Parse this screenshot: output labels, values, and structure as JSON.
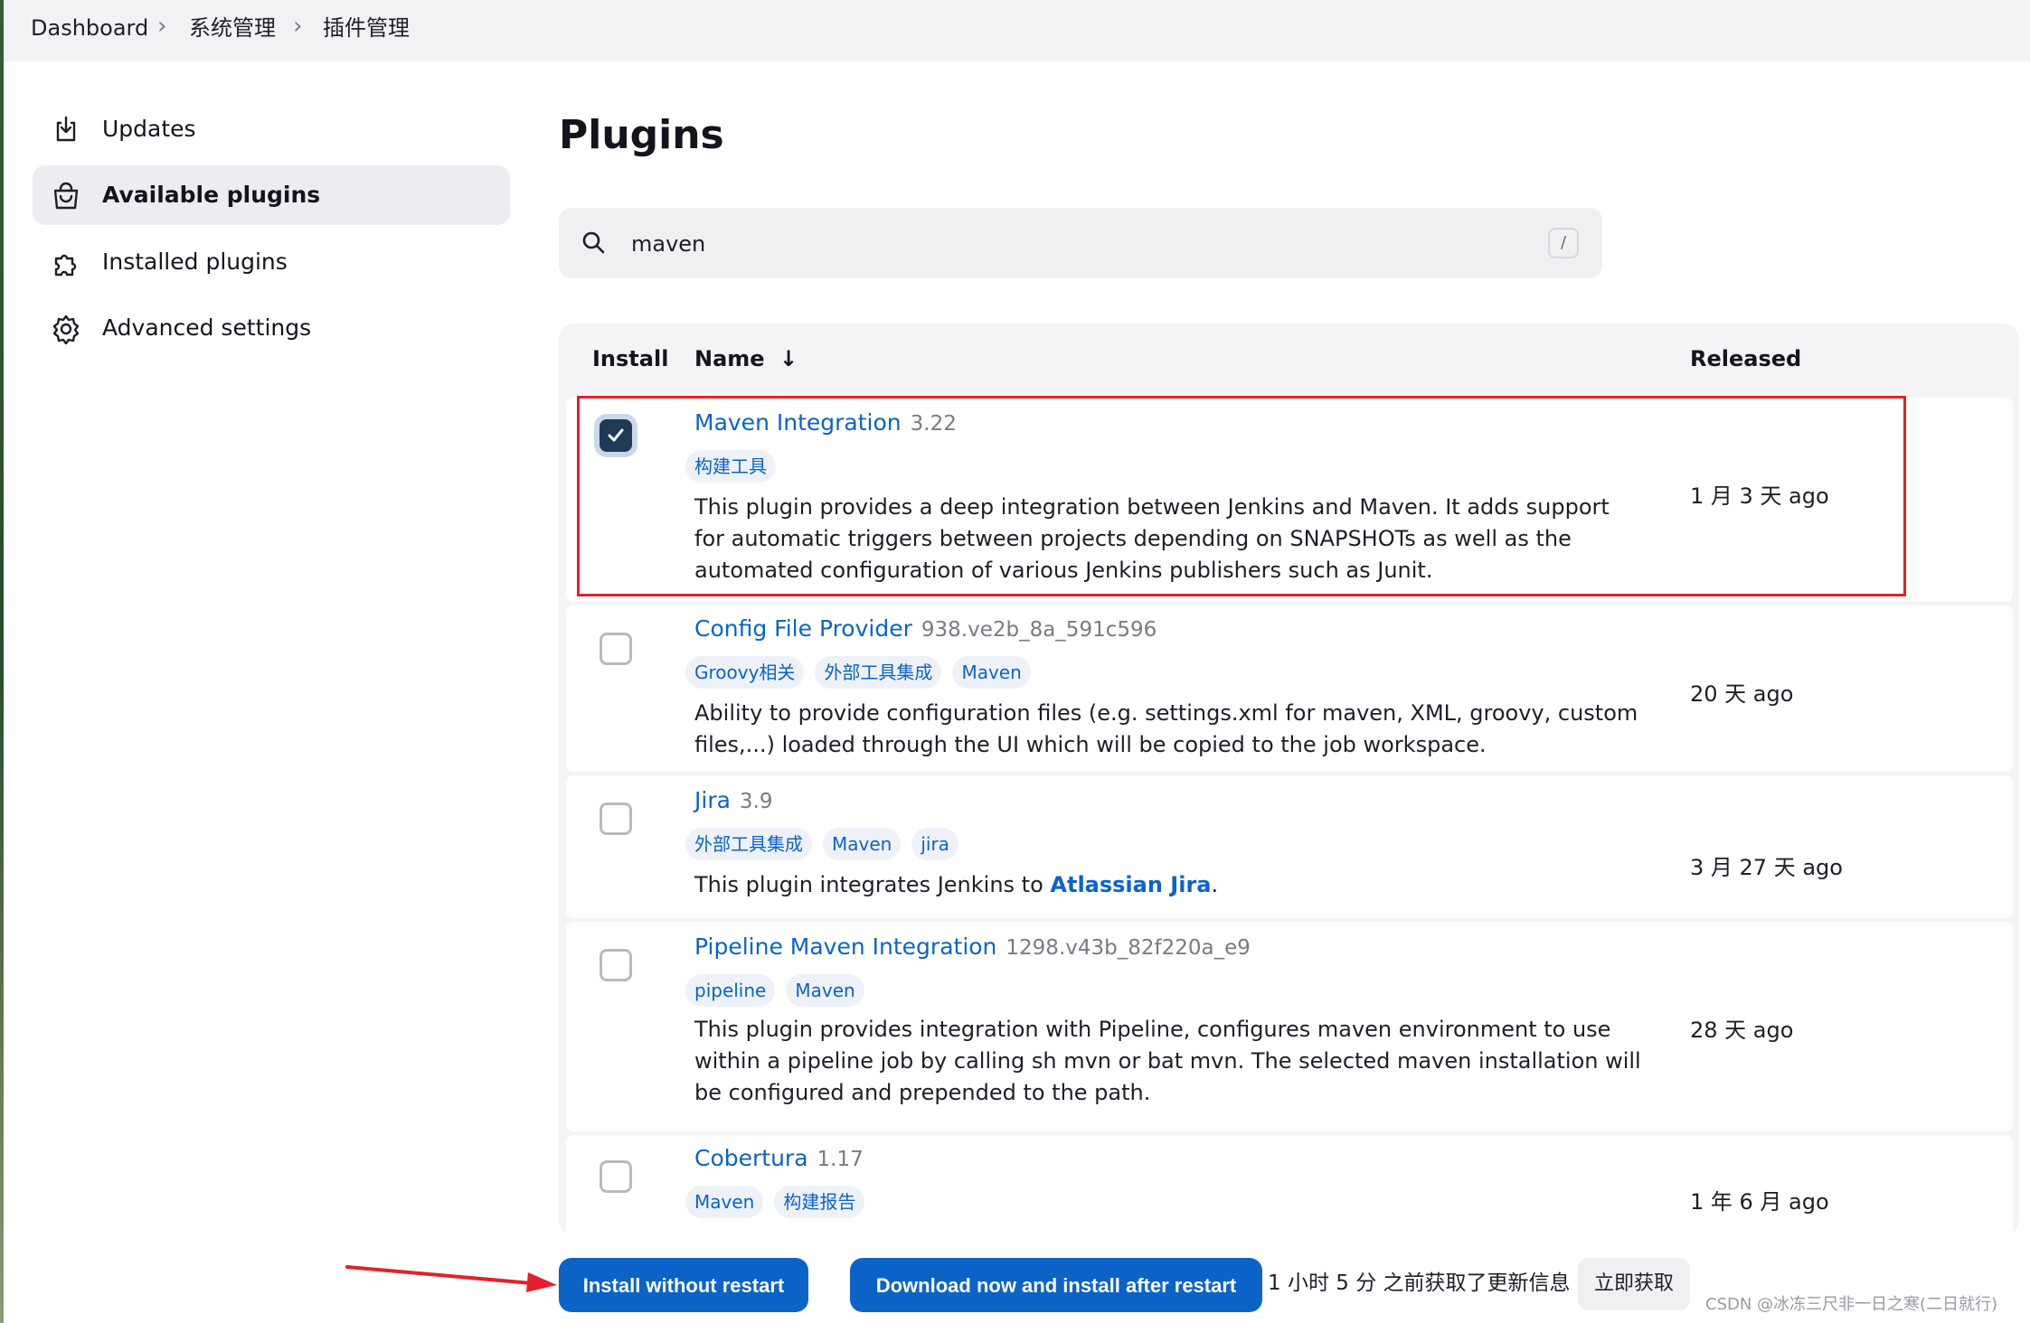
{
  "breadcrumb": {
    "items": [
      "Dashboard",
      "系统管理",
      "插件管理"
    ]
  },
  "sidebar": {
    "items": [
      {
        "label": "Updates",
        "icon": "download-icon"
      },
      {
        "label": "Available plugins",
        "icon": "shopping-bag-icon",
        "active": true
      },
      {
        "label": "Installed plugins",
        "icon": "puzzle-icon"
      },
      {
        "label": "Advanced settings",
        "icon": "gear-icon"
      }
    ]
  },
  "main": {
    "title": "Plugins",
    "search": {
      "value": "maven",
      "shortcut": "/"
    },
    "table": {
      "headers": {
        "install": "Install",
        "name": "Name",
        "sort_indicator": "↓",
        "released": "Released"
      },
      "rows": [
        {
          "name": "Maven Integration",
          "version": "3.22",
          "checked": true,
          "tags": [
            "构建工具"
          ],
          "description": "This plugin provides a deep integration between Jenkins and Maven. It adds support for automatic triggers between projects depending on SNAPSHOTs as well as the automated configuration of various Jenkins publishers such as Junit.",
          "released": "1 月 3 天 ago"
        },
        {
          "name": "Config File Provider",
          "version": "938.ve2b_8a_591c596",
          "checked": false,
          "tags": [
            "Groovy相关",
            "外部工具集成",
            "Maven"
          ],
          "description": "Ability to provide configuration files (e.g. settings.xml for maven, XML, groovy, custom files,...) loaded through the UI which will be copied to the job workspace.",
          "released": "20 天 ago"
        },
        {
          "name": "Jira",
          "version": "3.9",
          "checked": false,
          "tags": [
            "外部工具集成",
            "Maven",
            "jira"
          ],
          "description_prefix": "This plugin integrates Jenkins to ",
          "description_link": "Atlassian Jira",
          "description_suffix": ".",
          "released": "3 月 27 天 ago"
        },
        {
          "name": "Pipeline Maven Integration",
          "version": "1298.v43b_82f220a_e9",
          "checked": false,
          "tags": [
            "pipeline",
            "Maven"
          ],
          "description": "This plugin provides integration with Pipeline, configures maven environment to use within a pipeline job by calling sh mvn or bat mvn. The selected maven installation will be configured and prepended to the path.",
          "released": "28 天 ago"
        },
        {
          "name": "Cobertura",
          "version": "1.17",
          "checked": false,
          "tags": [
            "Maven",
            "构建报告"
          ],
          "released": "1 年 6 月 ago"
        }
      ]
    }
  },
  "actions": {
    "install_without_restart": "Install without restart",
    "download_after_restart": "Download now and install after restart",
    "update_status": "1 小时 5 分 之前获取了更新信息",
    "refresh": "立即获取"
  },
  "watermark": "CSDN @冰冻三尺非一日之寒(二日就行)",
  "colors": {
    "accent": "#0b63c8",
    "highlight_border": "#e3212b",
    "checked": "#1f3a57"
  }
}
